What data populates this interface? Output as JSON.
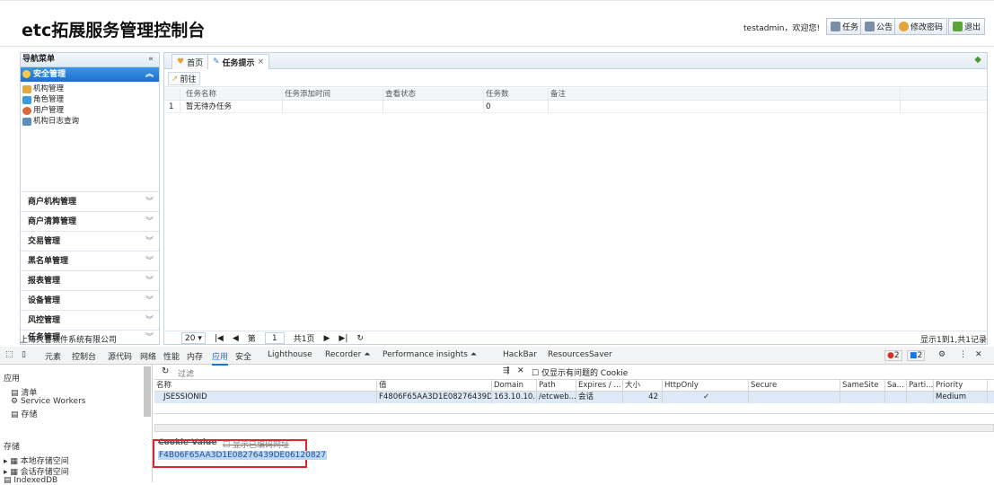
{
  "app": {
    "title": "etc拓展服务管理控制台",
    "welcome": "testadmin，欢迎您!",
    "header_buttons": [
      {
        "label": "任务",
        "icon": "task-icon"
      },
      {
        "label": "公告",
        "icon": "notice-icon"
      },
      {
        "label": "修改密码",
        "icon": "user-key-icon"
      },
      {
        "label": "退出",
        "icon": "logout-icon"
      }
    ]
  },
  "nav": {
    "title": "导航菜单",
    "collapse": "«",
    "open_section": "安全管理",
    "sub_items": [
      {
        "label": "机构管理",
        "icon": "org-icon"
      },
      {
        "label": "角色管理",
        "icon": "role-icon"
      },
      {
        "label": "用户管理",
        "icon": "user-icon"
      },
      {
        "label": "机构日志查询",
        "icon": "log-icon"
      }
    ],
    "groups": [
      "商户机构管理",
      "商户清算管理",
      "交易管理",
      "黑名单管理",
      "报表管理",
      "设备管理",
      "风控管理",
      "任务管理"
    ],
    "company": "上海久誉软件系统有限公司"
  },
  "main": {
    "tabs": [
      {
        "label": "首页",
        "icon": "home-icon"
      },
      {
        "label": "任务提示",
        "icon": "edit-icon",
        "close": "×"
      }
    ],
    "toolbar_button": "前往",
    "columns": [
      "任务名称",
      "任务添加时间",
      "查看状态",
      "任务数",
      "备注"
    ],
    "rows": [
      {
        "index": "1",
        "name": "暂无待办任务",
        "time": "",
        "status": "",
        "count": "0",
        "note": ""
      }
    ],
    "pager": {
      "page_size": "20",
      "page_label": "第",
      "page": "1",
      "total_pages": "共1页",
      "info": "显示1到1,共1记录"
    }
  },
  "devtools": {
    "tabs": [
      "元素",
      "控制台",
      "源代码",
      "网络",
      "性能",
      "内存",
      "应用",
      "安全",
      "Lighthouse",
      "Recorder ⏶",
      "Performance insights ⏶",
      "HackBar",
      "ResourcesSaver"
    ],
    "active_tab": "应用",
    "errors": "2",
    "messages": "2",
    "sidebar": {
      "app_label": "应用",
      "items": [
        "清单",
        "Service Workers",
        "存储"
      ],
      "storage_label": "存储",
      "storage_items": [
        "本地存储空间",
        "会话存储空间",
        "IndexedDB"
      ]
    },
    "cookies": {
      "filter_placeholder": "过滤",
      "only_issues": "仅显示有问题的 Cookie",
      "columns": [
        "名称",
        "值",
        "Domain",
        "Path",
        "Expires / ...",
        "大小",
        "HttpOnly",
        "Secure",
        "SameSite",
        "Sa...",
        "Parti...",
        "Priority"
      ],
      "row": {
        "name": "JSESSIONID",
        "value": "F4806F65AA3D1E08276439DE...",
        "domain": "163.10.10....",
        "path": "/etcweb...",
        "expires": "会话",
        "size": "42",
        "httponly": "✓",
        "secure": "",
        "samesite": "",
        "sa": "",
        "parti": "",
        "priority": "Medium"
      },
      "value_label": "Cookie Value",
      "show_decoded": "显示已编码网址",
      "cookie_value": "F4B06F65AA3D1E08276439DE06120827"
    }
  }
}
